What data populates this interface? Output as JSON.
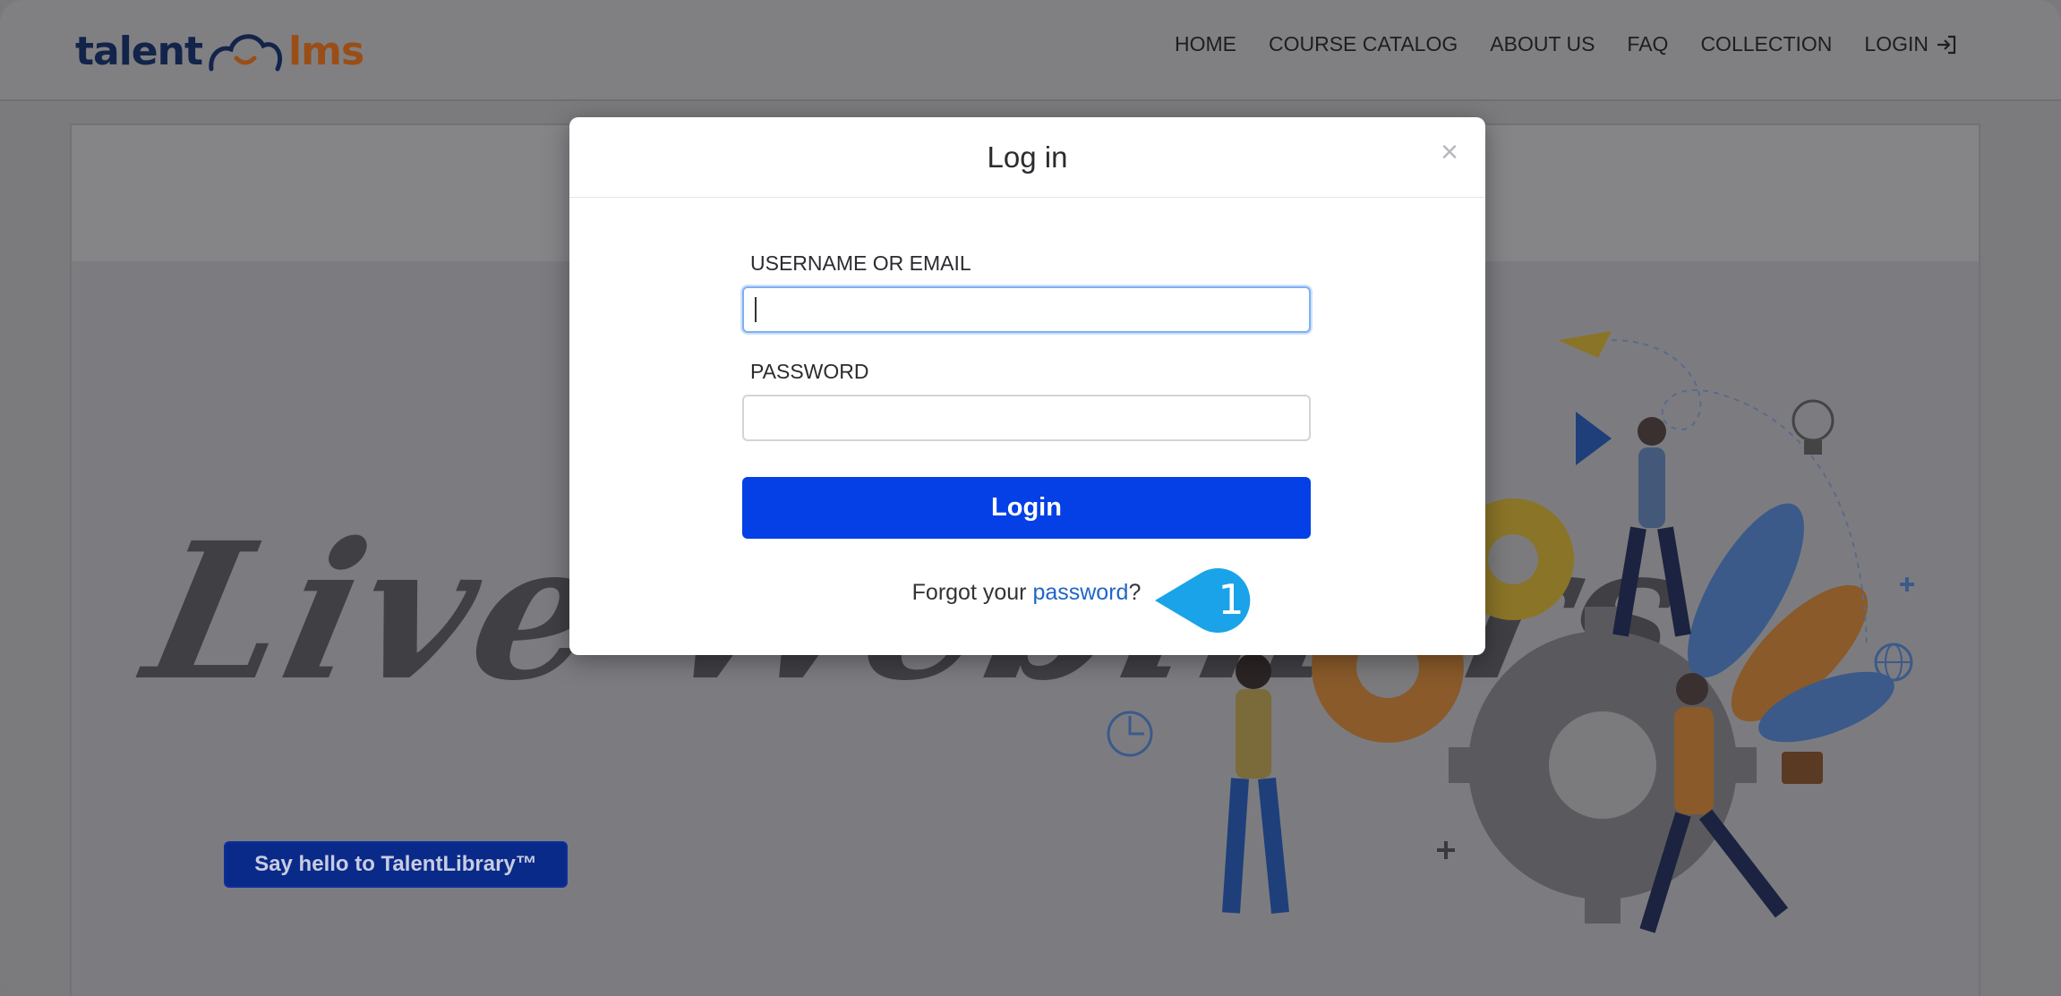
{
  "brand": {
    "part1": "talent",
    "part2": "lms"
  },
  "nav": {
    "items": [
      "HOME",
      "COURSE CATALOG",
      "ABOUT US",
      "FAQ",
      "COLLECTION",
      "LOGIN"
    ]
  },
  "hero": {
    "title": "Live Webinars",
    "button_label": "Say hello to TalentLibrary™"
  },
  "modal": {
    "title": "Log in",
    "close": "×",
    "username_label": "USERNAME OR EMAIL",
    "username_value": "",
    "password_label": "PASSWORD",
    "password_value": "",
    "login_button": "Login",
    "forgot_prefix": "Forgot your ",
    "forgot_link": "password",
    "forgot_suffix": "?"
  },
  "callout": {
    "step": "1",
    "color": "#1aa3e8"
  },
  "colors": {
    "primary_button": "#0440e6",
    "link": "#2066c8",
    "brand_dark": "#13244a",
    "brand_orange": "#9a4e17"
  }
}
